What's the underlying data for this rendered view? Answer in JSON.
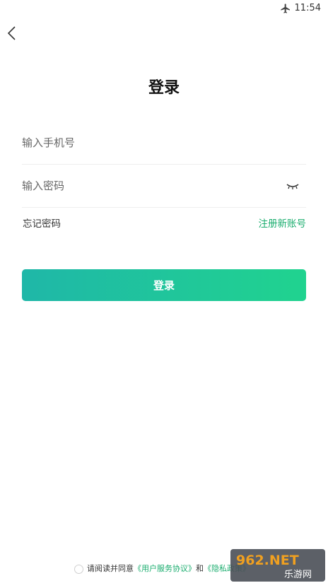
{
  "status_bar": {
    "time": "11:54",
    "airplane_icon": "airplane-icon"
  },
  "header": {
    "back_icon": "chevron-left-icon",
    "title": "登录"
  },
  "form": {
    "phone_placeholder": "输入手机号",
    "password_placeholder": "输入密码",
    "password_toggle_icon": "eye-closed-icon"
  },
  "links": {
    "forgot": "忘记密码",
    "register": "注册新账号"
  },
  "login_button": "登录",
  "agreement": {
    "prefix": "请阅读并同意",
    "user_agreement": "《用户服务协议》",
    "and": "和",
    "privacy": "《隐私政策》"
  },
  "watermark": {
    "brand": "962.NET",
    "sub": "乐游网"
  },
  "colors": {
    "accent": "#1aad6e",
    "button_start": "#1fb7a8",
    "button_end": "#20d38f"
  }
}
